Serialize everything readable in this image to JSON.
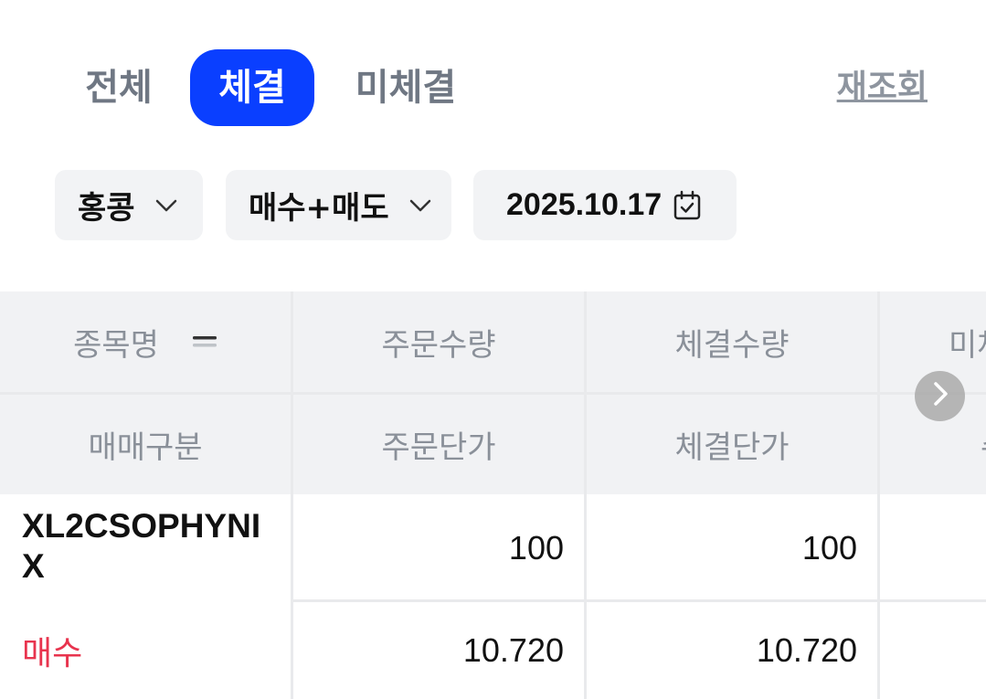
{
  "tabs": [
    {
      "label": "전체",
      "active": false
    },
    {
      "label": "체결",
      "active": true
    },
    {
      "label": "미체결",
      "active": false
    }
  ],
  "refresh_label": "재조회",
  "filters": {
    "market": "홍콩",
    "side": "매수+매도",
    "date": "2025.10.17"
  },
  "table": {
    "header_row1": [
      "종목명",
      "주문수량",
      "체결수량",
      "미체"
    ],
    "header_row2": [
      "매매구분",
      "주문단가",
      "체결단가",
      "수"
    ],
    "rows": [
      {
        "name": "XL2CSOPHYNIX",
        "side": "매수",
        "order_qty": "100",
        "filled_qty": "100",
        "order_price": "10.720",
        "filled_price": "10.720"
      }
    ]
  },
  "colors": {
    "accent": "#0a3fff",
    "buy": "#e8344e"
  },
  "icons": {
    "filter_dropdown": "chevron-down-icon",
    "date_picker": "calendar-check-icon",
    "sort": "sort-icon",
    "scroll_next": "chevron-right-icon"
  }
}
